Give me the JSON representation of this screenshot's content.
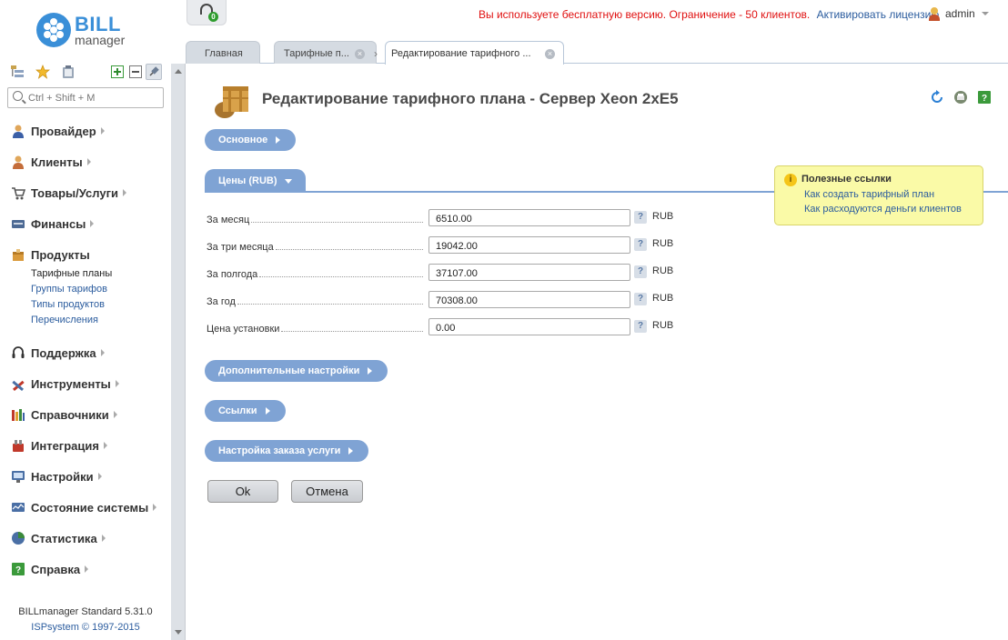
{
  "brand": {
    "name": "BILL",
    "sub": "manager"
  },
  "topbar": {
    "support_badge": "0",
    "notice": "Вы используете бесплатную версию. Ограничение - 50 клиентов.",
    "notice_link": "Активировать лицензию",
    "user": "admin"
  },
  "search": {
    "placeholder": "Ctrl + Shift + M"
  },
  "nav": {
    "items": [
      {
        "label": "Провайдер"
      },
      {
        "label": "Клиенты"
      },
      {
        "label": "Товары/Услуги"
      },
      {
        "label": "Финансы"
      },
      {
        "label": "Продукты"
      },
      {
        "label": "Поддержка"
      },
      {
        "label": "Инструменты"
      },
      {
        "label": "Справочники"
      },
      {
        "label": "Интеграция"
      },
      {
        "label": "Настройки"
      },
      {
        "label": "Состояние системы"
      },
      {
        "label": "Статистика"
      },
      {
        "label": "Справка"
      }
    ],
    "sub_items": [
      {
        "label": "Тарифные планы"
      },
      {
        "label": "Группы тарифов"
      },
      {
        "label": "Типы продуктов"
      },
      {
        "label": "Перечисления"
      }
    ]
  },
  "footer": {
    "version": "BILLmanager Standard 5.31.0",
    "copyright": "ISPsystem © 1997-2015"
  },
  "tabs": [
    {
      "label": "Главная"
    },
    {
      "label": "Тарифные п..."
    },
    {
      "label": "Редактирование тарифного ..."
    }
  ],
  "page": {
    "title": "Редактирование тарифного плана - Сервер Xeon 2xE5"
  },
  "sections": {
    "main": "Основное",
    "prices": "Цены (RUB)",
    "extra": "Дополнительные настройки",
    "links": "Ссылки",
    "order": "Настройка заказа услуги"
  },
  "prices": [
    {
      "label": "За месяц",
      "value": "6510.00",
      "currency": "RUB"
    },
    {
      "label": "За три месяца",
      "value": "19042.00",
      "currency": "RUB"
    },
    {
      "label": "За полгода",
      "value": "37107.00",
      "currency": "RUB"
    },
    {
      "label": "За год",
      "value": "70308.00",
      "currency": "RUB"
    },
    {
      "label": "Цена установки",
      "value": "0.00",
      "currency": "RUB"
    }
  ],
  "help_mark": "?",
  "buttons": {
    "ok": "Ok",
    "cancel": "Отмена"
  },
  "useful_links": {
    "title": "Полезные ссылки",
    "links": [
      "Как создать тарифный план",
      "Как расходуются деньги клиентов"
    ]
  },
  "colors": {
    "accent": "#7fa3d4",
    "brand": "#3a8fd8",
    "notice": "#e01010",
    "link": "#2b5c9e"
  }
}
